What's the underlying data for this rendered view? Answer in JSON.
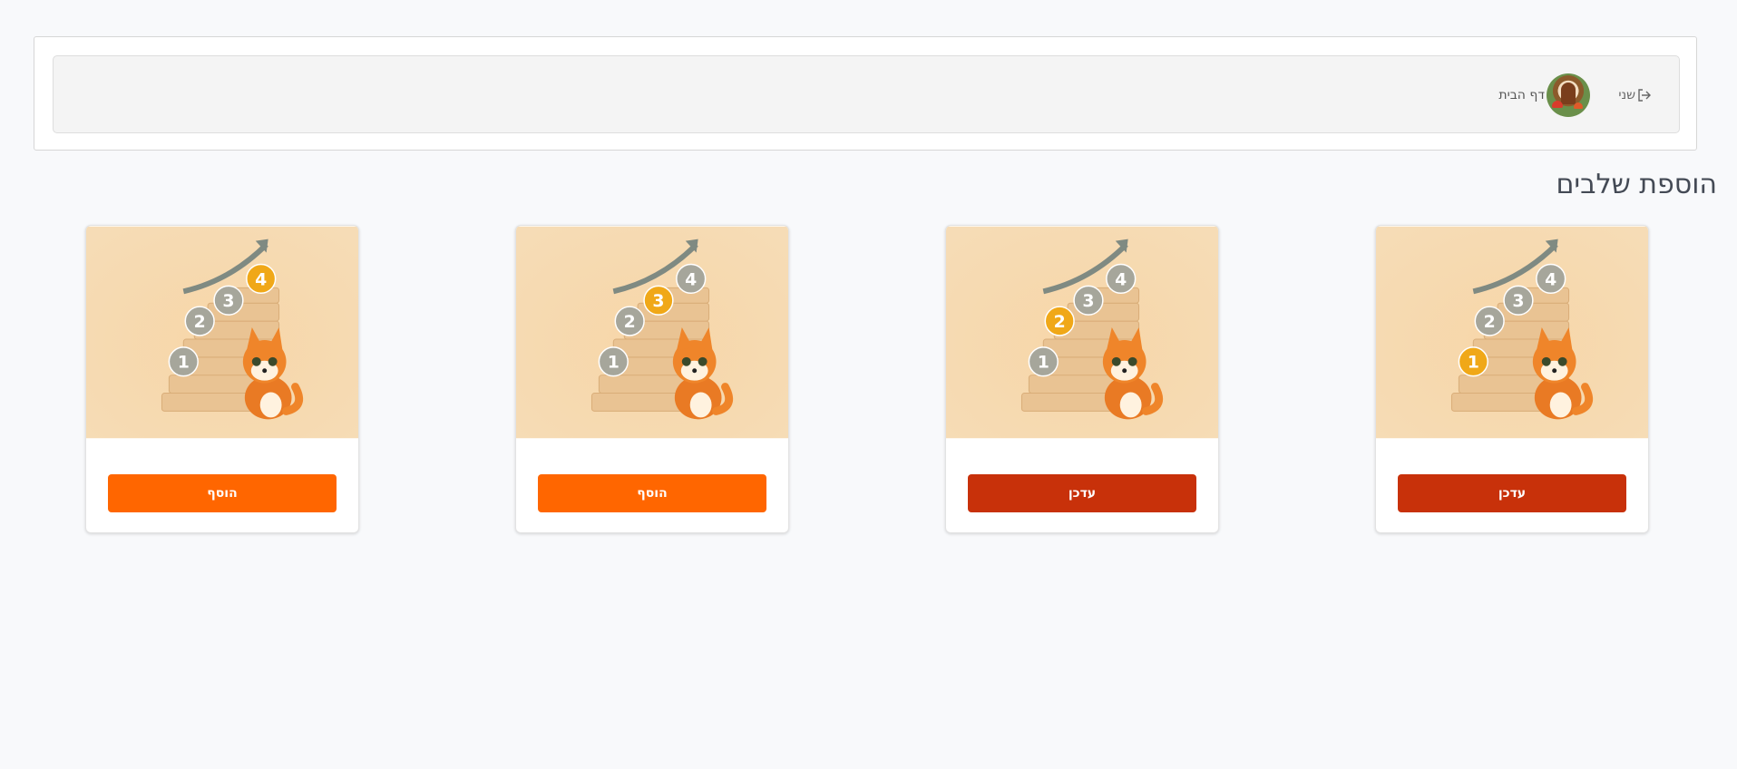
{
  "nav": {
    "logout_label": "שני",
    "home_label": "דף הבית"
  },
  "page": {
    "title": "הוספת שלבים"
  },
  "colors": {
    "update_button": "#c8310a",
    "add_button": "#ff6600",
    "active_step": "#f0a818",
    "inactive_step": "#a6a69b"
  },
  "cards": [
    {
      "step_labels": [
        "1",
        "2",
        "3",
        "4"
      ],
      "highlighted_step": 4,
      "button_label": "הוסף",
      "button_kind": "add"
    },
    {
      "step_labels": [
        "1",
        "2",
        "3",
        "4"
      ],
      "highlighted_step": 3,
      "button_label": "הוסף",
      "button_kind": "add"
    },
    {
      "step_labels": [
        "1",
        "2",
        "3",
        "4"
      ],
      "highlighted_step": 2,
      "button_label": "עדכן",
      "button_kind": "update"
    },
    {
      "step_labels": [
        "1",
        "2",
        "3",
        "4"
      ],
      "highlighted_step": 1,
      "button_label": "עדכן",
      "button_kind": "update"
    }
  ]
}
